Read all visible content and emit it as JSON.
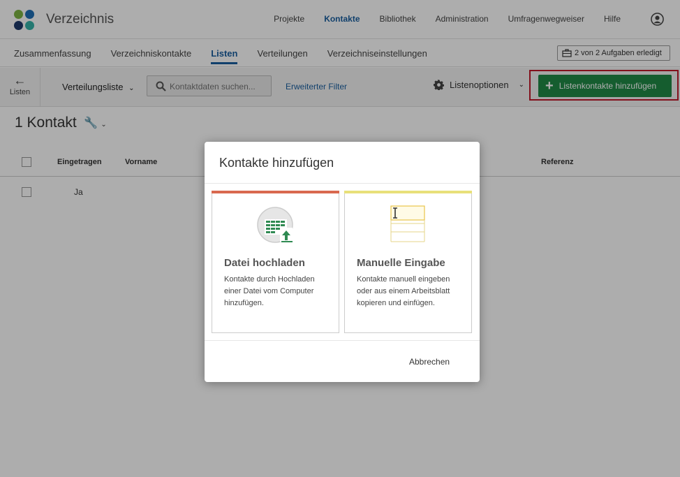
{
  "header": {
    "app_title": "Verzeichnis",
    "nav": [
      "Projekte",
      "Kontakte",
      "Bibliothek",
      "Administration",
      "Umfragenwegweiser",
      "Hilfe"
    ],
    "active_nav": "Kontakte"
  },
  "subnav": {
    "tabs": [
      "Zusammenfassung",
      "Verzeichniskontakte",
      "Listen",
      "Verteilungen",
      "Verzeichniseinstellungen"
    ],
    "tasks_label": "2 von 2 Aufgaben erledigt"
  },
  "toolbar": {
    "back_label": "Listen",
    "list_name": "Verteilungsliste",
    "search_placeholder": "Kontaktdaten suchen...",
    "extended_filter": "Erweiterter Filter",
    "list_options": "Listenoptionen",
    "add_button": "Listenkontakte hinzufügen"
  },
  "content": {
    "count": "1 Kontakt",
    "columns": [
      "Eingetragen",
      "Vorname",
      "Referenz"
    ],
    "rows": [
      {
        "eingetragen": "Ja"
      }
    ]
  },
  "modal": {
    "title": "Kontakte hinzufügen",
    "cards": [
      {
        "title": "Datei hochladen",
        "desc": "Kontakte durch Hochladen einer Datei vom Computer hinzufügen.",
        "accent": "#d9694f"
      },
      {
        "title": "Manuelle Eingabe",
        "desc": "Kontakte manuell eingeben oder aus einem Arbeitsblatt kopieren und einfügen.",
        "accent": "#e8e07a"
      }
    ],
    "cancel": "Abbrechen"
  },
  "colors": {
    "accent_blue": "#1a5fa0",
    "add_button_green": "#1f8a46",
    "highlight_red": "#c0182a"
  }
}
